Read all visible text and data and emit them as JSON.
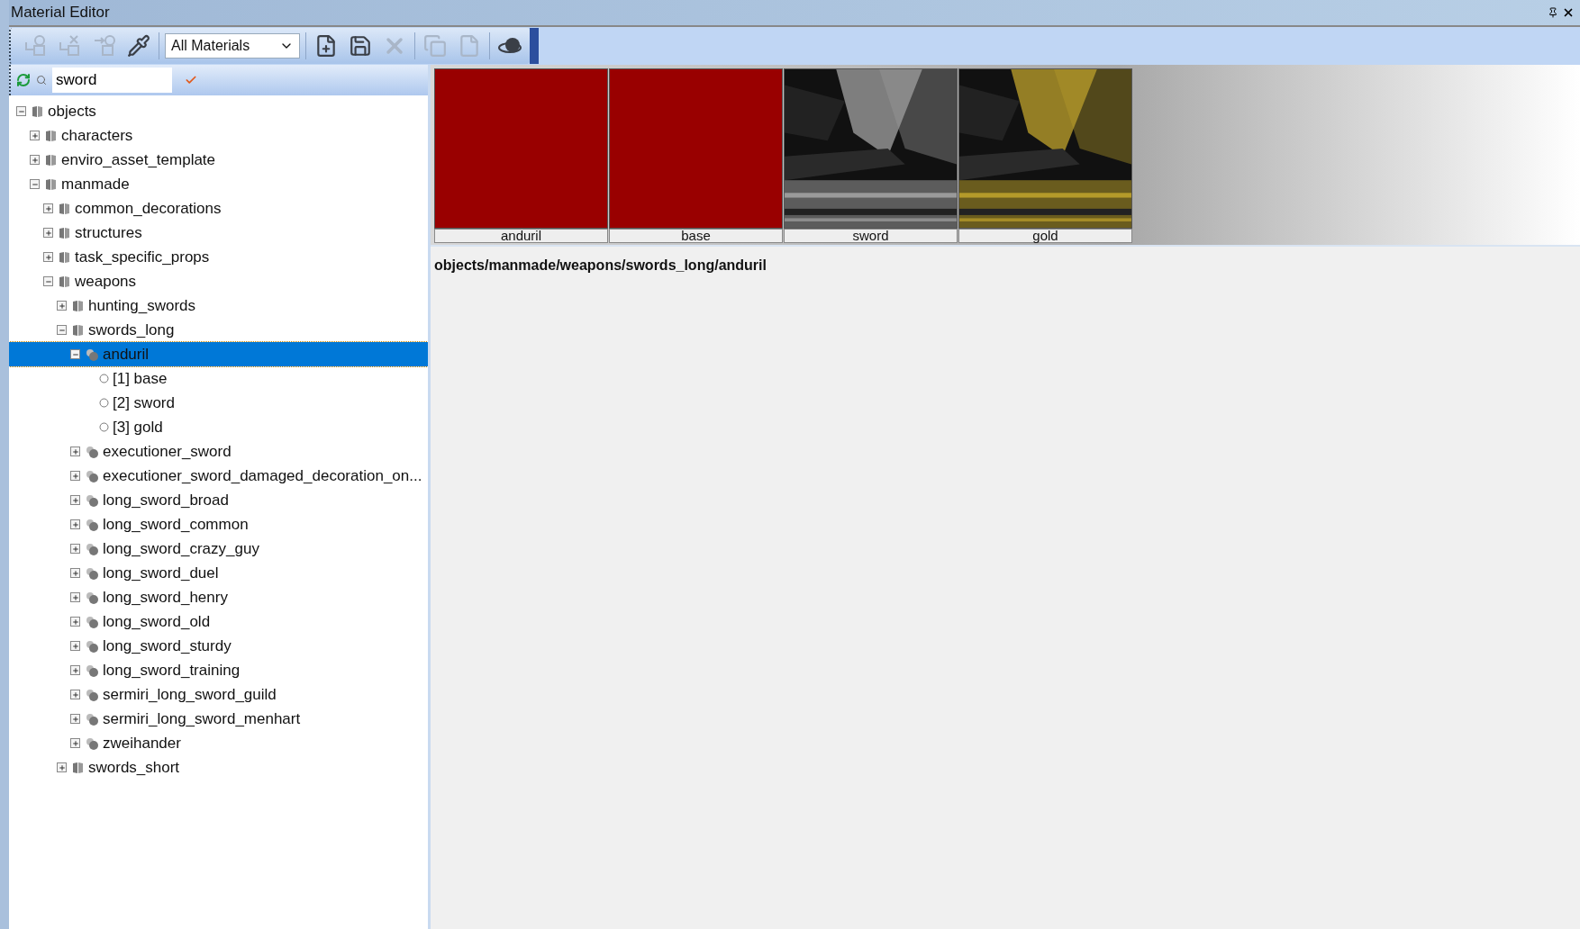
{
  "window": {
    "title": "Material Editor"
  },
  "toolbar": [
    {
      "kind": "box-in",
      "disabled": true
    },
    {
      "kind": "box-remove",
      "disabled": true
    },
    {
      "kind": "box-swap",
      "disabled": true
    },
    {
      "kind": "pipette",
      "disabled": false
    },
    {
      "kind": "separator"
    },
    {
      "kind": "dropdown",
      "value": "All Materials"
    },
    {
      "kind": "separator"
    },
    {
      "kind": "file-new",
      "disabled": false
    },
    {
      "kind": "save",
      "disabled": false
    },
    {
      "kind": "delete",
      "disabled": true
    },
    {
      "kind": "separator"
    },
    {
      "kind": "copy",
      "disabled": true
    },
    {
      "kind": "paste",
      "disabled": true
    },
    {
      "kind": "separator"
    },
    {
      "kind": "sphere",
      "disabled": false
    }
  ],
  "search": {
    "value": "sword"
  },
  "tree": [
    {
      "label": "objects",
      "kind": "folder",
      "expanded": true,
      "selected": false,
      "children": [
        {
          "label": "characters",
          "kind": "folder",
          "expanded": false,
          "selected": false
        },
        {
          "label": "enviro_asset_template",
          "kind": "folder",
          "expanded": false,
          "selected": false
        },
        {
          "label": "manmade",
          "kind": "folder",
          "expanded": true,
          "selected": false,
          "children": [
            {
              "label": "common_decorations",
              "kind": "folder",
              "expanded": false,
              "selected": false
            },
            {
              "label": "structures",
              "kind": "folder",
              "expanded": false,
              "selected": false
            },
            {
              "label": "task_specific_props",
              "kind": "folder",
              "expanded": false,
              "selected": false
            },
            {
              "label": "weapons",
              "kind": "folder",
              "expanded": true,
              "selected": false,
              "children": [
                {
                  "label": "hunting_swords",
                  "kind": "folder",
                  "expanded": false,
                  "selected": false
                },
                {
                  "label": "swords_long",
                  "kind": "folder",
                  "expanded": true,
                  "selected": false,
                  "children": [
                    {
                      "label": "anduril",
                      "kind": "material",
                      "expanded": true,
                      "selected": true,
                      "children": [
                        {
                          "label": "[1] base",
                          "kind": "slot",
                          "selected": false
                        },
                        {
                          "label": "[2] sword",
                          "kind": "slot",
                          "selected": false
                        },
                        {
                          "label": "[3] gold",
                          "kind": "slot",
                          "selected": false
                        }
                      ]
                    },
                    {
                      "label": "executioner_sword",
                      "kind": "material",
                      "expanded": false,
                      "selected": false
                    },
                    {
                      "label": "executioner_sword_damaged_decoration_on...",
                      "kind": "material",
                      "expanded": false,
                      "selected": false
                    },
                    {
                      "label": "long_sword_broad",
                      "kind": "material",
                      "expanded": false,
                      "selected": false
                    },
                    {
                      "label": "long_sword_common",
                      "kind": "material",
                      "expanded": false,
                      "selected": false
                    },
                    {
                      "label": "long_sword_crazy_guy",
                      "kind": "material",
                      "expanded": false,
                      "selected": false
                    },
                    {
                      "label": "long_sword_duel",
                      "kind": "material",
                      "expanded": false,
                      "selected": false
                    },
                    {
                      "label": "long_sword_henry",
                      "kind": "material",
                      "expanded": false,
                      "selected": false
                    },
                    {
                      "label": "long_sword_old",
                      "kind": "material",
                      "expanded": false,
                      "selected": false
                    },
                    {
                      "label": "long_sword_sturdy",
                      "kind": "material",
                      "expanded": false,
                      "selected": false
                    },
                    {
                      "label": "long_sword_training",
                      "kind": "material",
                      "expanded": false,
                      "selected": false
                    },
                    {
                      "label": "sermiri_long_sword_guild",
                      "kind": "material",
                      "expanded": false,
                      "selected": false
                    },
                    {
                      "label": "sermiri_long_sword_menhart",
                      "kind": "material",
                      "expanded": false,
                      "selected": false
                    },
                    {
                      "label": "zweihander",
                      "kind": "material",
                      "expanded": false,
                      "selected": false
                    }
                  ]
                },
                {
                  "label": "swords_short",
                  "kind": "folder",
                  "expanded": false,
                  "selected": false
                }
              ]
            }
          ]
        }
      ]
    }
  ],
  "thumbnails": [
    {
      "label": "anduril",
      "kind": "solid",
      "color": "#990000"
    },
    {
      "label": "base",
      "kind": "solid",
      "color": "#990000"
    },
    {
      "label": "sword",
      "kind": "picture",
      "color": "#9a9a9a"
    },
    {
      "label": "gold",
      "kind": "picture",
      "color": "#b59a2a"
    }
  ],
  "path": "objects/manmade/weapons/swords_long/anduril"
}
